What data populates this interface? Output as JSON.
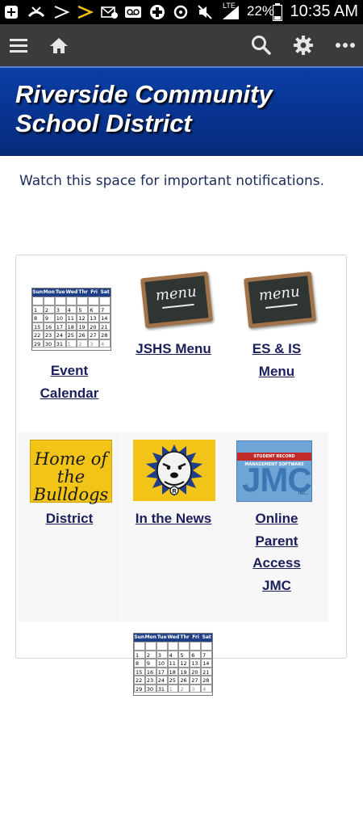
{
  "status_bar": {
    "battery": "22%",
    "network": "LTE",
    "time": "10:35 AM"
  },
  "toolbar": {
    "menu_icon": "menu-icon",
    "home_icon": "home-icon",
    "search_icon": "search-icon",
    "settings_icon": "gear-icon",
    "more_icon": "more-icon"
  },
  "header": {
    "title": "Riverside Community School District",
    "title_line1": "Riverside Community",
    "title_line2": "School District"
  },
  "notice": "Watch this space for important notifications.",
  "calendar_icon": {
    "weekdays": [
      "Sun",
      "Mon",
      "Tue",
      "Wed",
      "Thr",
      "Fri",
      "Sat"
    ],
    "days": [
      [
        "",
        "",
        "",
        "",
        "",
        "",
        ""
      ],
      [
        "1",
        "2",
        "3",
        "4",
        "5",
        "6",
        "7"
      ],
      [
        "8",
        "9",
        "10",
        "11",
        "12",
        "13",
        "14"
      ],
      [
        "15",
        "16",
        "17",
        "18",
        "19",
        "20",
        "21"
      ],
      [
        "22",
        "23",
        "24",
        "25",
        "26",
        "27",
        "28"
      ],
      [
        "29",
        "30",
        "31",
        "1",
        "2",
        "3",
        "4"
      ]
    ]
  },
  "board_text": "menu",
  "tiles": {
    "event_calendar": [
      "Event",
      "Calendar"
    ],
    "jshs_menu": [
      "JSHS Menu"
    ],
    "es_is_menu": [
      "ES & IS",
      "Menu"
    ],
    "district": [
      "District"
    ],
    "in_the_news": [
      "In the News"
    ],
    "online_parent_access": [
      "Online",
      "Parent",
      "Access",
      "JMC"
    ]
  },
  "district_logo_text": [
    "Home of",
    "the Bulldogs"
  ],
  "jmc_logo": {
    "strip": "STUDENT RECORD MANAGEMENT SOFTWARE",
    "letters": "JMC",
    "inc": "INC."
  },
  "colors": {
    "banner": "#08338f",
    "toolbar": "#3b3b3b",
    "link": "#1a1f5c",
    "tile_yellow": "#f2c418"
  }
}
